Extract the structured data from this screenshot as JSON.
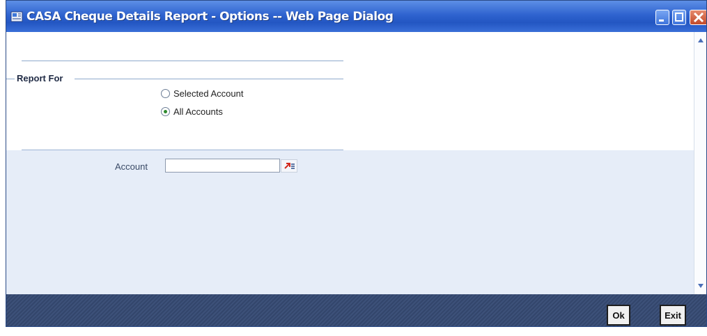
{
  "window": {
    "title": "CASA Cheque Details Report - Options -- Web Page Dialog"
  },
  "report_for": {
    "legend": "Report For",
    "options": [
      {
        "label": "Selected Account",
        "selected": false
      },
      {
        "label": "All Accounts",
        "selected": true
      }
    ]
  },
  "account": {
    "label": "Account",
    "value": ""
  },
  "footer": {
    "ok_label": "Ok",
    "exit_label": "Exit"
  },
  "colors": {
    "titlebar": "#2f63cf",
    "footer": "#33466c",
    "lower_panel": "#e6edf8"
  },
  "icons": [
    "window-icon",
    "minimize-icon",
    "maximize-icon",
    "close-icon",
    "lov-search-icon",
    "scroll-up-icon",
    "scroll-down-icon"
  ]
}
